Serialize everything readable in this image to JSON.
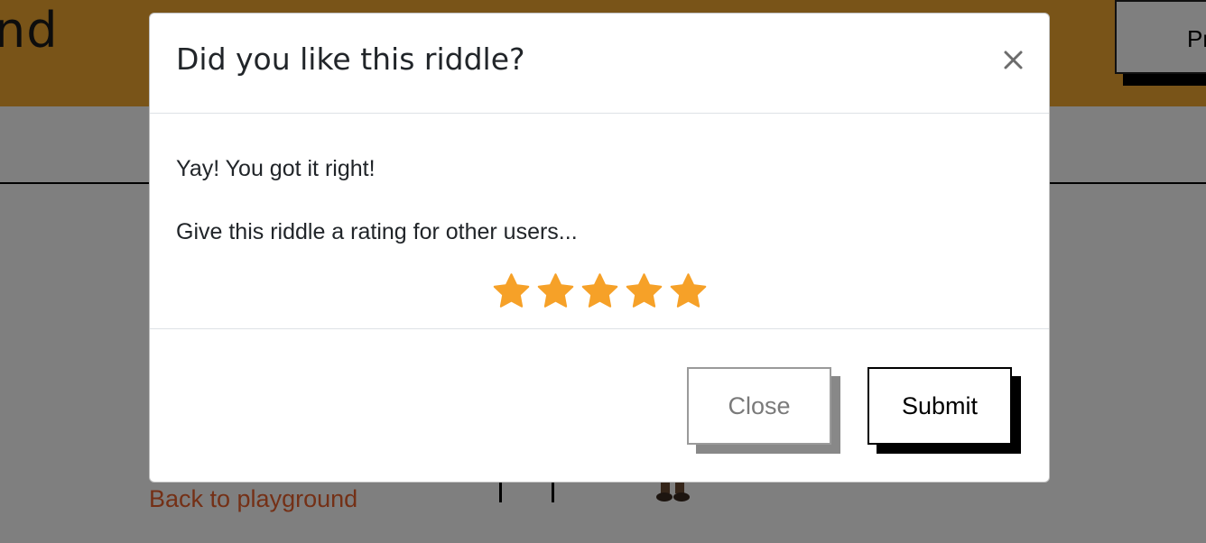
{
  "header": {
    "brand_fragment": "nd",
    "profile_button_fragment": "Pr"
  },
  "page": {
    "back_link": "Back to playground"
  },
  "modal": {
    "title": "Did you like this riddle?",
    "close_icon": "close-icon",
    "message": "Yay! You got it right!",
    "prompt": "Give this riddle a rating for other users...",
    "rating": {
      "max": 5,
      "selected": 5,
      "star_color": "#f6a128",
      "icon": "star-icon"
    },
    "buttons": {
      "close_label": "Close",
      "submit_label": "Submit"
    }
  },
  "colors": {
    "header_bg": "#f2a930",
    "link": "#e8602c",
    "overlay": "rgba(0,0,0,0.5)"
  }
}
